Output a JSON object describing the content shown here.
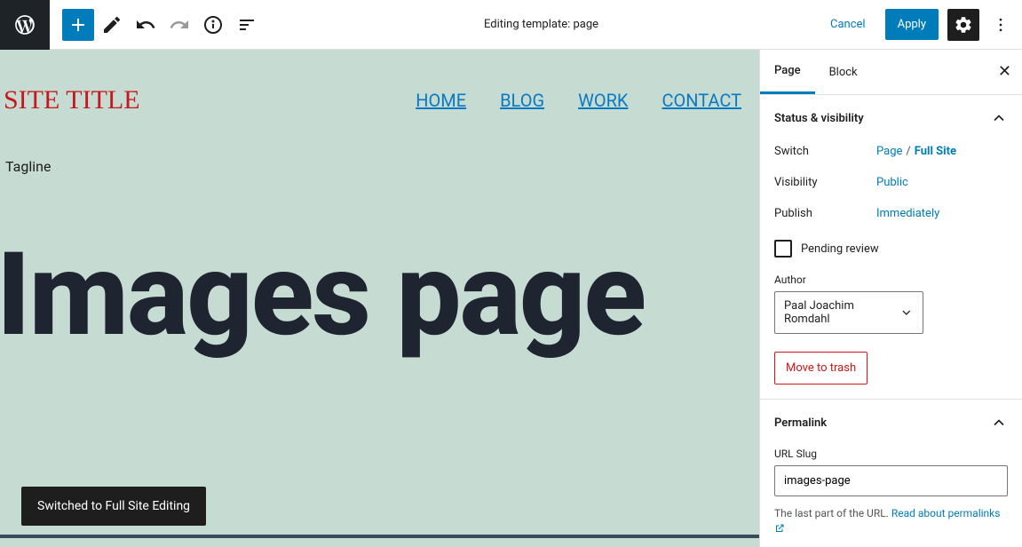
{
  "topbar": {
    "title": "Editing template: page",
    "cancel": "Cancel",
    "apply": "Apply"
  },
  "canvas": {
    "site_title": "SITE TITLE",
    "nav": [
      "HOME",
      "BLOG",
      "WORK",
      "CONTACT"
    ],
    "tagline": "Tagline",
    "page_title": "Images page",
    "toast": "Switched to Full Site Editing"
  },
  "sidebar": {
    "tabs": {
      "page": "Page",
      "block": "Block"
    },
    "status": {
      "heading": "Status & visibility",
      "switch_label": "Switch",
      "switch_page": "Page",
      "switch_full": "Full Site",
      "visibility_label": "Visibility",
      "visibility_value": "Public",
      "publish_label": "Publish",
      "publish_value": "Immediately",
      "pending": "Pending review",
      "author_label": "Author",
      "author_value": "Paal Joachim Romdahl",
      "trash": "Move to trash"
    },
    "permalink": {
      "heading": "Permalink",
      "slug_label": "URL Slug",
      "slug_value": "images-page",
      "helper_prefix": "The last part of the URL. ",
      "helper_link": "Read about permalinks"
    }
  }
}
